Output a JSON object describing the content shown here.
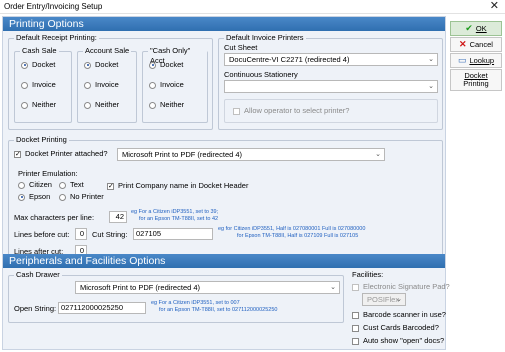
{
  "window": {
    "title": "Order Entry/Invoicing Setup",
    "close_glyph": "✕"
  },
  "printing_options": {
    "header": "Printing Options",
    "default_receipt": {
      "label": "Default Receipt Printing:",
      "columns": [
        {
          "label": "Cash Sale",
          "options": [
            "Docket",
            "Invoice",
            "Neither"
          ],
          "selected": 0
        },
        {
          "label": "Account Sale",
          "options": [
            "Docket",
            "Invoice",
            "Neither"
          ],
          "selected": 0
        },
        {
          "label": "\"Cash Only\" Acct",
          "options": [
            "Docket",
            "Invoice",
            "Neither"
          ],
          "selected": 0
        }
      ]
    },
    "default_invoice": {
      "label": "Default Invoice Printers",
      "cut_sheet_label": "Cut Sheet",
      "cut_sheet_value": "DocuCentre-VI C2271 (redirected 4)",
      "continuous_label": "Continuous Stationery",
      "continuous_value": "",
      "allow_select_label": "Allow operator to select printer?"
    },
    "docket": {
      "label": "Docket Printing",
      "attached_label": "Docket Printer attached?",
      "attached_checked": true,
      "printer_value": "Microsoft Print to PDF (redirected 4)",
      "emulation_label": "Printer Emulation:",
      "emulation_options": [
        "Citizen",
        "Text",
        "Epson",
        "No Printer"
      ],
      "emulation_selected": "Epson",
      "print_company_label": "Print Company name in Docket Header",
      "print_company_checked": true,
      "max_chars_label": "Max characters per line:",
      "max_chars_value": "42",
      "max_chars_hint1": "eg For a Citizen iDP3551, set to 39;",
      "max_chars_hint2": "for an Epson TM-T88II, set to 42",
      "lines_before_label": "Lines before cut:",
      "lines_before_value": "0",
      "cut_string_label": "Cut String:",
      "cut_string_value": "027105",
      "cut_hint1": "eg for Citizen iDP3551, Half is 027080001 Full is 027080000",
      "cut_hint2": "for Epson TM-T88II, Half is 027109 Full is 027105",
      "lines_after_label": "Lines after cut:",
      "lines_after_value": "0"
    }
  },
  "peripherals": {
    "header": "Peripherals and Facilities Options",
    "cash_drawer": {
      "label": "Cash Drawer",
      "printer_value": "Microsoft Print to PDF (redirected 4)",
      "open_string_label": "Open String:",
      "open_string_value": "027112000025250",
      "hint1": "eg For a Citizen iDP3551, set to 007",
      "hint2": "for an Epson TM-T88II, set to 027112000025250"
    },
    "facilities": {
      "label": "Facilities:",
      "items": [
        "Electronic Signature Pad?",
        "Barcode scanner in use?",
        "Cust Cards Barcoded?",
        "Auto show \"open\" docs?"
      ],
      "sig_pad_device": "POSIFlex"
    }
  },
  "sidebar": {
    "ok_label": "OK",
    "cancel_label": "Cancel",
    "lookup_label": "Lookup",
    "docket_printing_label_1": "Docket",
    "docket_printing_label_2": "Printing"
  },
  "colors": {
    "band": "#3a7bbf",
    "panel": "#eef2f8",
    "hint": "#2060c0",
    "ok_icon": "#1b9a1b",
    "cancel_icon": "#d01818"
  }
}
